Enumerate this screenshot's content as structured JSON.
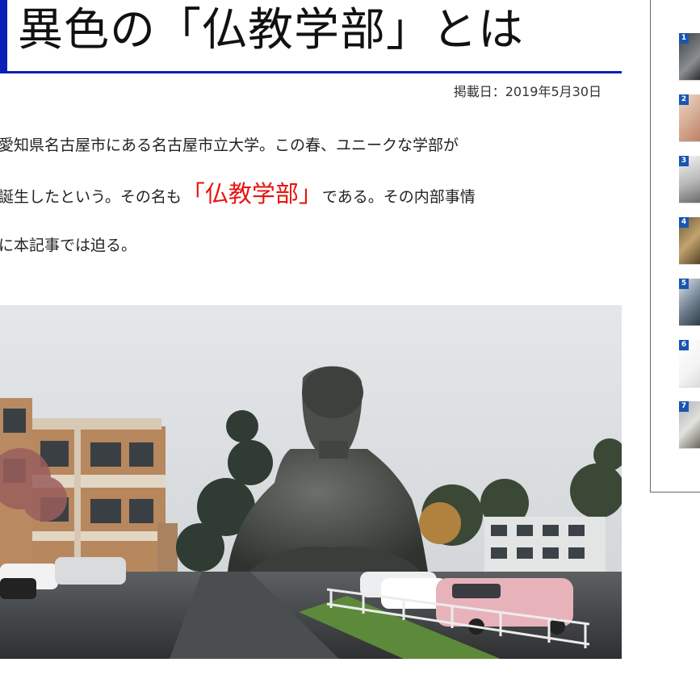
{
  "article": {
    "title": "異色の「仏教学部」とは",
    "date": "掲載日：2019年5月30日",
    "lead_line1": "愛知県名古屋市にある名古屋市立大学。この春、ユニークな学部が",
    "lead_line2_before": "誕生したという。その名も",
    "lead_line2_highlight": "「仏教学部」",
    "lead_line2_after": "である。その内部事情",
    "lead_line3": "に本記事では迫る。",
    "highlight_color": "#e8130f",
    "accent_color": "#0a1fb8"
  },
  "sidebar": {
    "header": "",
    "ranking": [
      {
        "rank": "1"
      },
      {
        "rank": "2"
      },
      {
        "rank": "3"
      },
      {
        "rank": "4"
      },
      {
        "rank": "5"
      },
      {
        "rank": "6"
      },
      {
        "rank": "7"
      }
    ],
    "badge_color": "#1a55b0"
  }
}
